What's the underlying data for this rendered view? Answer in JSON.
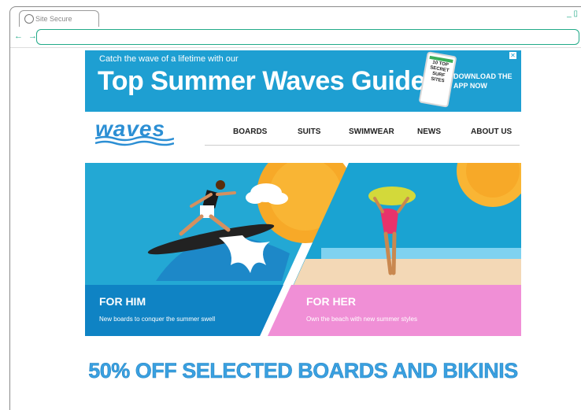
{
  "browser": {
    "tab_title": "Site Secure",
    "nav_arrows": "← →",
    "window_controls": "_ ▯",
    "address_value": ""
  },
  "banner": {
    "tagline": "Catch the wave of a lifetime with our",
    "headline": "Top Summer Waves Guide",
    "phone_text": "10 TOP SECRET SURF SITES",
    "cta_line1": "DOWNLOAD THE",
    "cta_line2": "APP NOW",
    "close_icon": "close-icon"
  },
  "header": {
    "logo": "waves",
    "nav": [
      "BOARDS",
      "SUITS",
      "SWIMWEAR",
      "NEWS",
      "ABOUT US"
    ]
  },
  "hero": {
    "him": {
      "title": "FOR HIM",
      "subtitle": "New boards to conquer the summer swell"
    },
    "her": {
      "title": "FOR HER",
      "subtitle": "Own the beach with new summer styles"
    }
  },
  "promo": "50% OFF SELECTED BOARDS AND BIKINIS",
  "colors": {
    "accent": "#1e9fd2",
    "her_panel": "#f08fd6",
    "sun": "#f7a928"
  }
}
